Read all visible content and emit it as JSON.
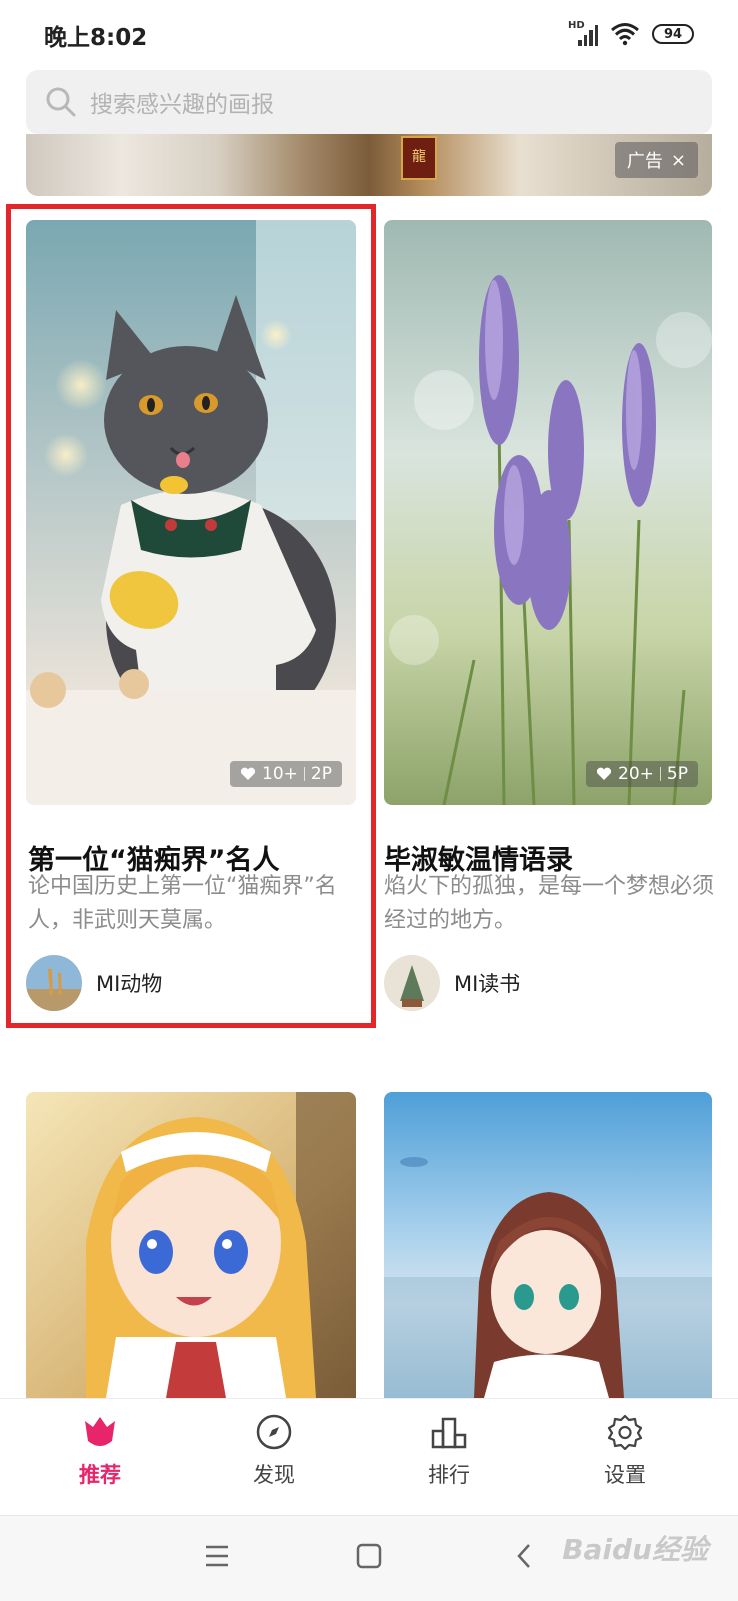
{
  "status_bar": {
    "time": "晚上8:02",
    "network": "HD",
    "battery": "94"
  },
  "search": {
    "placeholder": "搜索感兴趣的画报"
  },
  "ad": {
    "plaque_text": "龍",
    "tag_label": "广告",
    "close_symbol": "×"
  },
  "cards": [
    {
      "title": "第一位“猫痴界”名人",
      "description": "论中国历史上第一位“猫痴界”名人，非武则天莫属。",
      "likes": "10+",
      "pages": "2P",
      "author": "MI动物",
      "highlighted": true
    },
    {
      "title": "毕淑敏温情语录",
      "description": "焰火下的孤独，是每一个梦想必须经过的地方。",
      "likes": "20+",
      "pages": "5P",
      "author": "MI读书",
      "highlighted": false
    }
  ],
  "tabs": [
    {
      "label": "推荐",
      "icon": "tulip-icon",
      "active": true
    },
    {
      "label": "发现",
      "icon": "compass-icon",
      "active": false
    },
    {
      "label": "排行",
      "icon": "ranking-icon",
      "active": false
    },
    {
      "label": "设置",
      "icon": "gear-icon",
      "active": false
    }
  ],
  "watermark": "Baidu经验",
  "colors": {
    "accent": "#e8246a",
    "highlight_border": "#e3262a"
  }
}
